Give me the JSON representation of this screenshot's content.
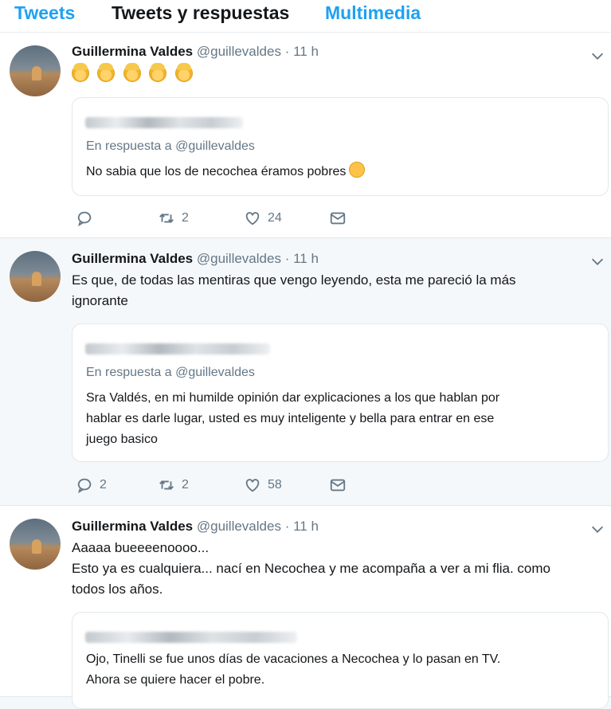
{
  "tabs": [
    "Tweets",
    "Tweets y respuestas",
    "Multimedia"
  ],
  "tweets": [
    {
      "name": "Guillermina Valdes",
      "handle": "@guillevaldes",
      "separator": "·",
      "time": "11 h",
      "text_lines": [],
      "emoji_icons": [
        "woman-tipping-hand-icon",
        "woman-tipping-hand-icon",
        "woman-tipping-hand-icon",
        "woman-tipping-hand-icon",
        "woman-tipping-hand-icon"
      ],
      "quote": {
        "reply_to": "En respuesta a @guillevaldes",
        "lines": [
          "No sabia que los de necochea éramos pobres"
        ]
      },
      "counts": {
        "reply": "",
        "retweet": "2",
        "like": "24"
      }
    },
    {
      "name": "Guillermina Valdes",
      "handle": "@guillevaldes",
      "separator": "·",
      "time": "11 h",
      "text_lines": [
        "Es que, de todas las mentiras que vengo leyendo, esta me pareció la más",
        "ignorante"
      ],
      "quote": {
        "reply_to": "En respuesta a @guillevaldes",
        "lines": [
          "Sra Valdés, en mi humilde opinión dar explicaciones a los que hablan por",
          "hablar es darle lugar, usted es muy inteligente y bella para entrar en ese",
          "juego basico"
        ]
      },
      "counts": {
        "reply": "2",
        "retweet": "2",
        "like": "58"
      }
    },
    {
      "name": "Guillermina Valdes",
      "handle": "@guillevaldes",
      "separator": "·",
      "time": "11 h",
      "text_lines": [
        "Aaaaa bueeeenoooo...",
        "Esto ya es cualquiera... nací en Necochea y me acompaña a ver a mi flia. como",
        "todos los años."
      ],
      "quote": {
        "reply_to": "",
        "lines": [
          "Ojo, Tinelli se fue unos días de vacaciones a Necochea y lo pasan en TV.",
          "Ahora se quiere hacer el pobre."
        ]
      }
    }
  ],
  "colors": {
    "accent": "#1da1f2",
    "muted": "#657786"
  }
}
